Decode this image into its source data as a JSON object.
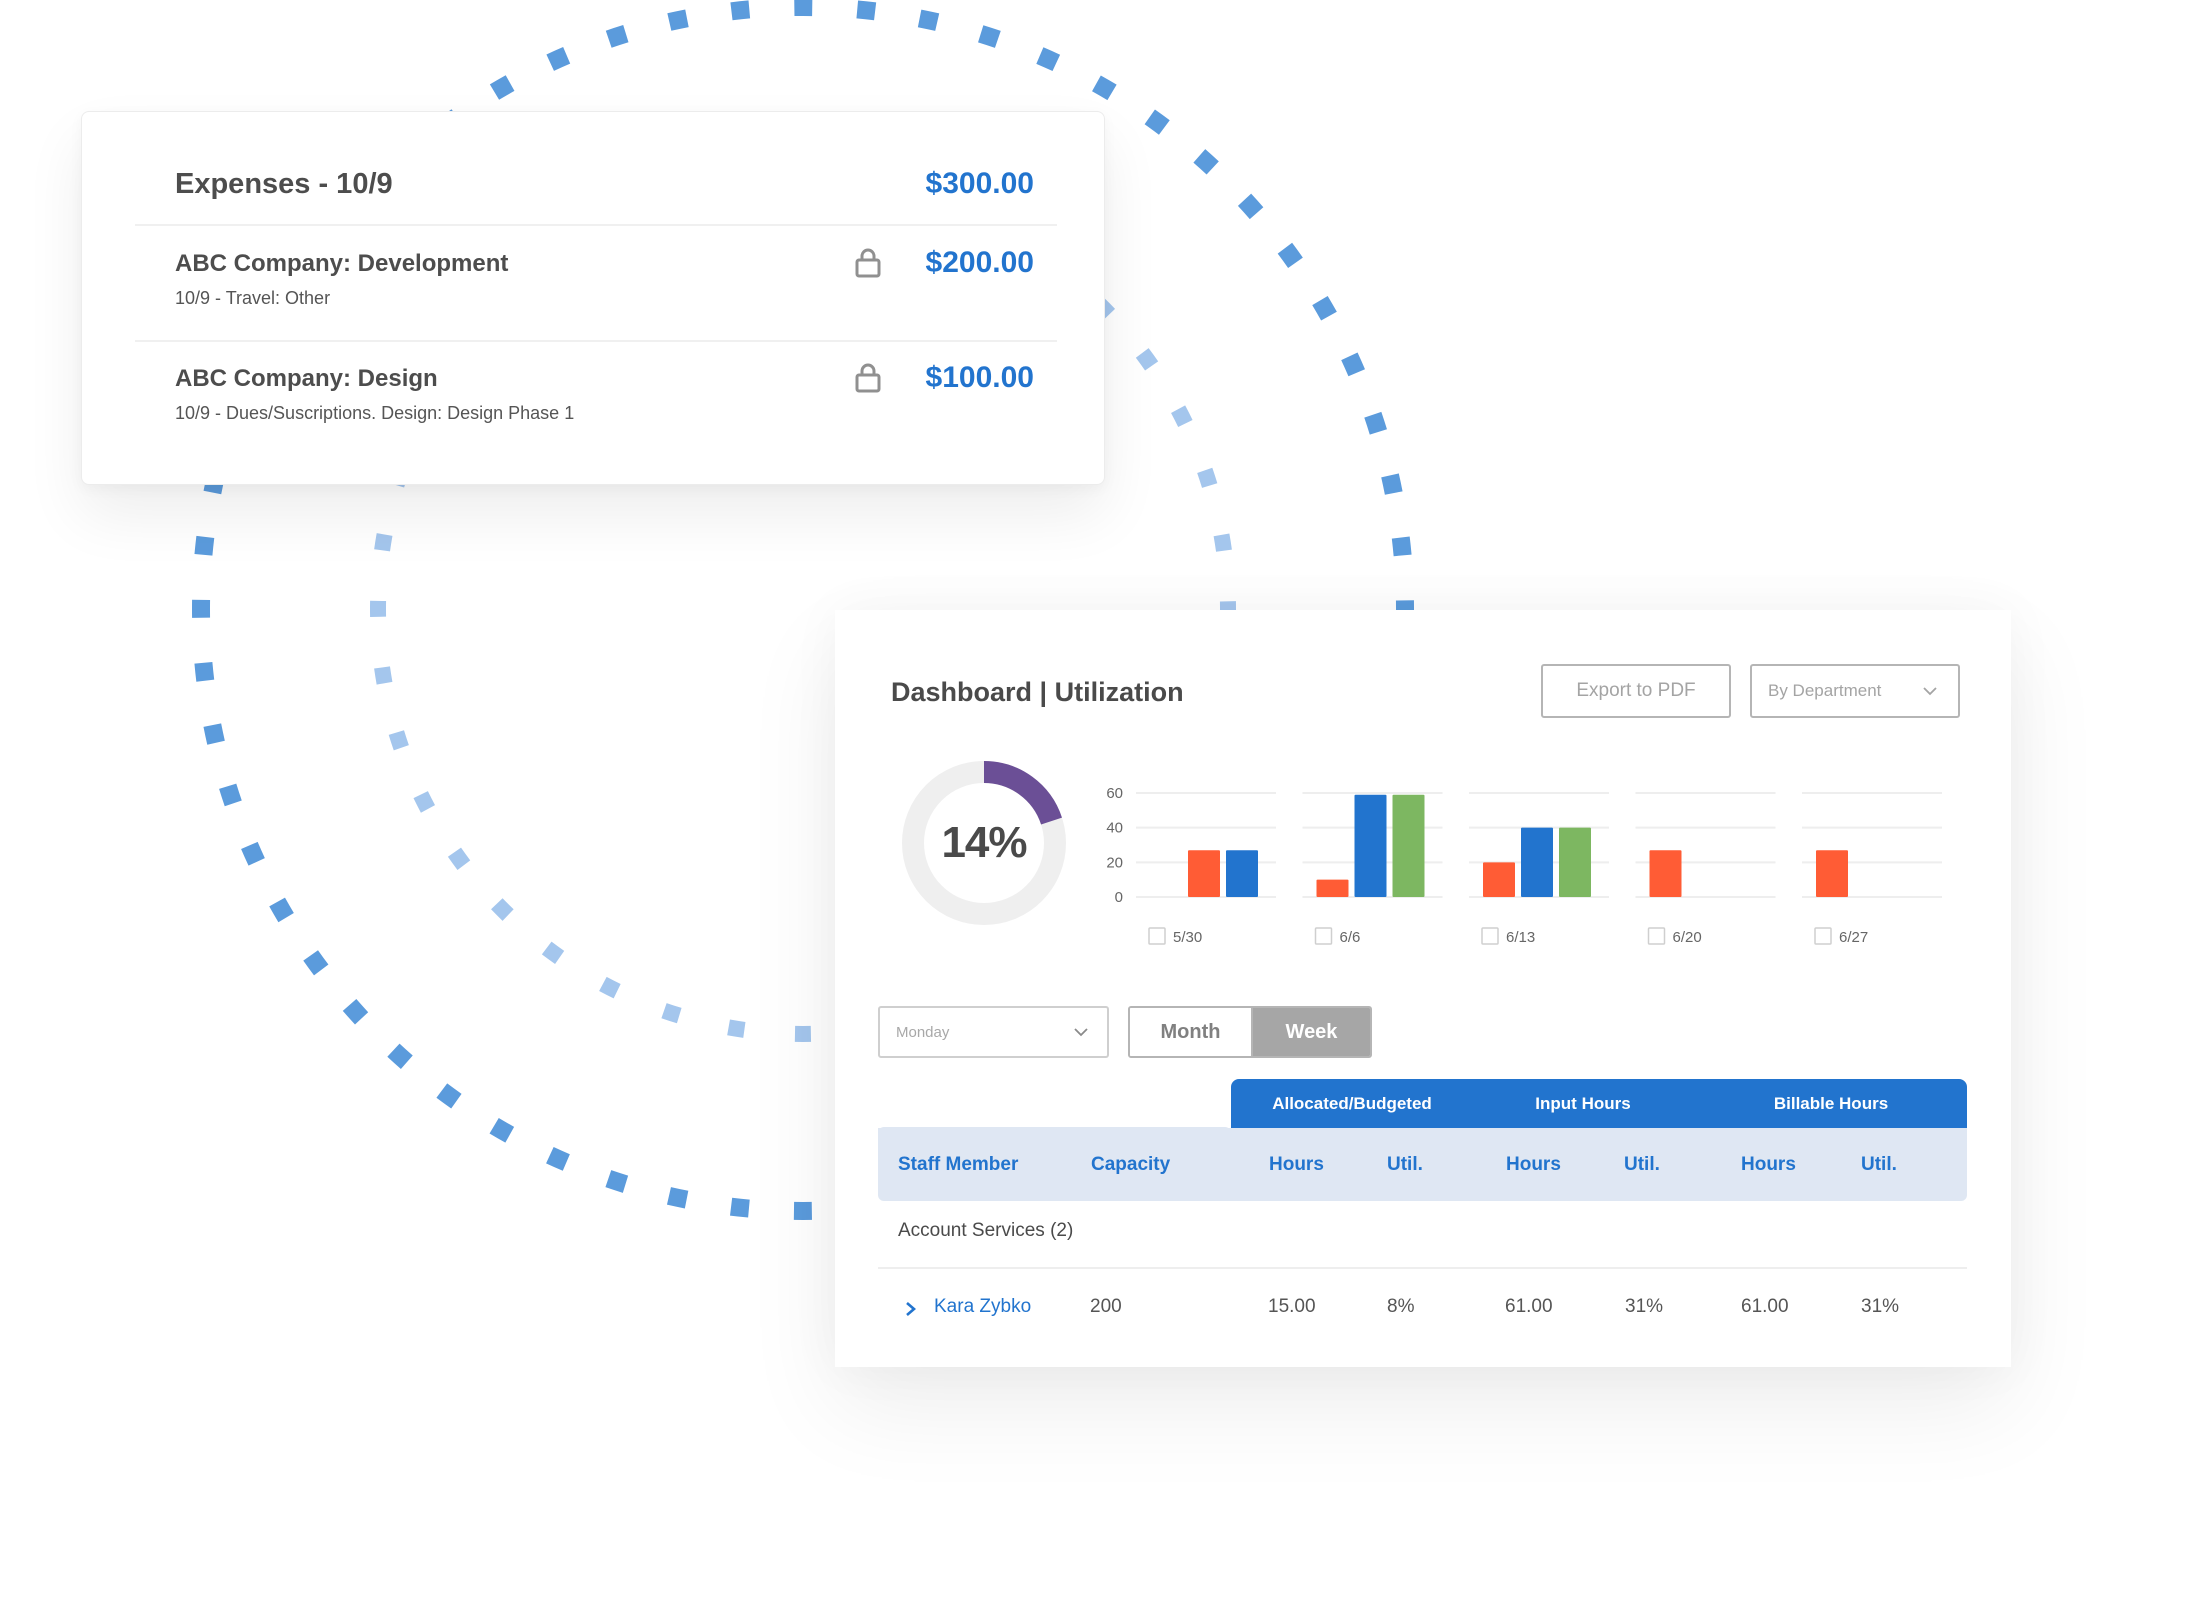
{
  "colors": {
    "accent_blue": "#2274ce",
    "ring_outer": "#5b9bdc",
    "ring_inner": "#a4c6ed",
    "donut_fill": "#6b4f96",
    "donut_track": "#efefef",
    "bar_orange": "#ff5c35",
    "bar_blue": "#2274ce",
    "bar_green": "#7db761"
  },
  "expenses_card": {
    "title": "Expenses - 10/9",
    "total": "$300.00",
    "items": [
      {
        "title": "ABC Company: Development",
        "subtitle": "10/9 - Travel: Other",
        "amount": "$200.00",
        "icon": "lock-icon"
      },
      {
        "title": "ABC Company: Design",
        "subtitle": "10/9 - Dues/Suscriptions. Design: Design Phase 1",
        "amount": "$100.00",
        "icon": "lock-icon"
      }
    ]
  },
  "dashboard": {
    "title": "Dashboard | Utilization",
    "export_label": "Export to PDF",
    "group_by": {
      "selected": "By Department",
      "icon": "chevron-down-icon"
    },
    "utilization": {
      "label": "14%",
      "value_percent": 14,
      "arc_fill_fraction": 0.2
    },
    "day_select": {
      "selected": "Monday",
      "icon": "chevron-down-icon"
    },
    "period_toggle": {
      "options": [
        "Month",
        "Week"
      ],
      "active": "Week"
    },
    "table": {
      "group_headers": [
        "Allocated/Budgeted",
        "Input Hours",
        "Billable Hours"
      ],
      "columns": [
        "Staff Member",
        "Capacity",
        "Hours",
        "Util.",
        "Hours",
        "Util.",
        "Hours",
        "Util."
      ],
      "groups": [
        {
          "label": "Account Services (2)",
          "rows": [
            {
              "icon": "chevron-right-icon",
              "cells": [
                "Kara Zybko",
                "200",
                "15.00",
                "8%",
                "61.00",
                "31%",
                "61.00",
                "31%"
              ]
            }
          ]
        }
      ]
    }
  },
  "chart_data": {
    "type": "bar",
    "title": "",
    "xlabel": "",
    "ylabel": "",
    "categories": [
      "5/30",
      "6/6",
      "6/13",
      "6/20",
      "6/27"
    ],
    "category_checkboxes": [
      false,
      false,
      false,
      false,
      false
    ],
    "yticks": [
      0,
      20,
      40,
      60
    ],
    "ylim": [
      0,
      60
    ],
    "grid": true,
    "legend": "none",
    "series": [
      {
        "name": "orange",
        "color": "#ff5c35",
        "values": [
          27,
          10,
          20,
          27,
          27
        ]
      },
      {
        "name": "blue",
        "color": "#2274ce",
        "values": [
          27,
          59,
          40,
          null,
          null
        ]
      },
      {
        "name": "green",
        "color": "#7db761",
        "values": [
          null,
          59,
          40,
          null,
          null
        ]
      }
    ]
  }
}
